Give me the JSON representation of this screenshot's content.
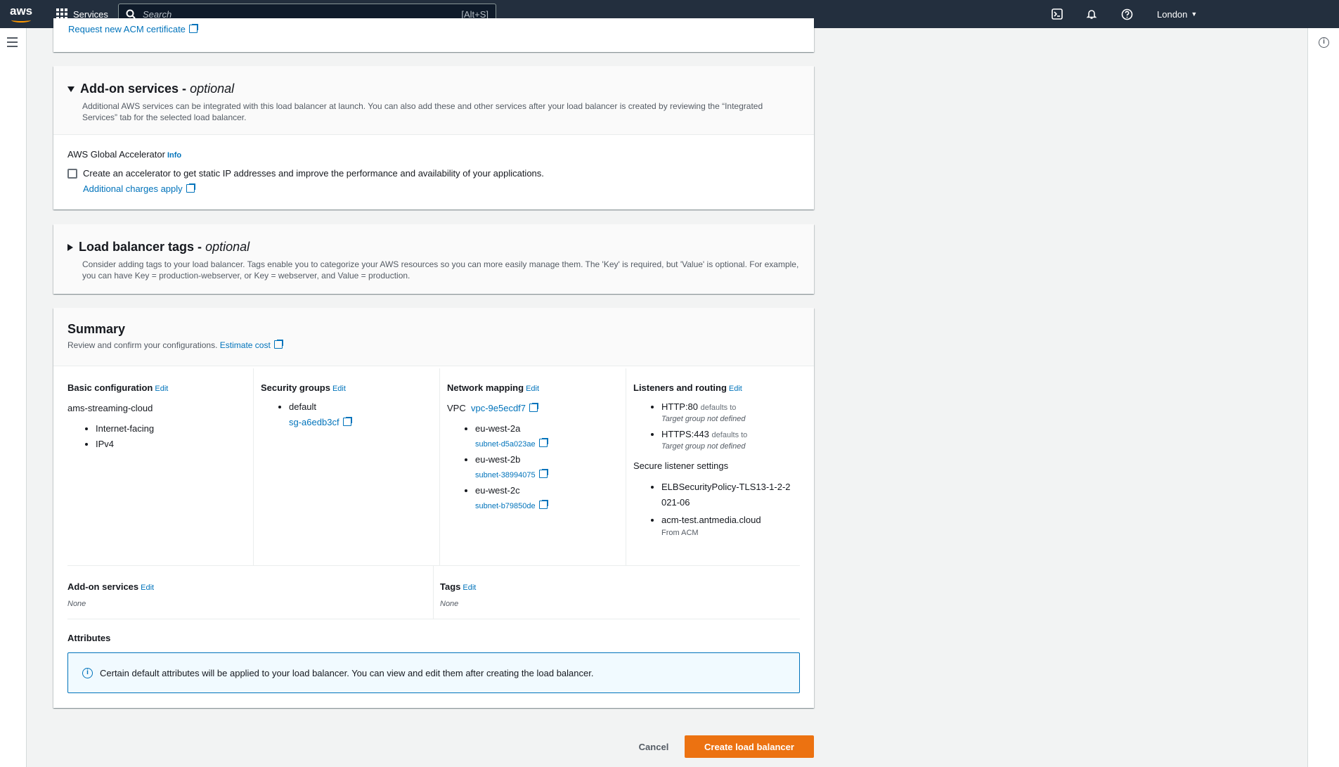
{
  "topnav": {
    "logo": "aws",
    "services": "Services",
    "search_placeholder": "Search",
    "search_shortcut": "[Alt+S]",
    "region": "London",
    "icons": [
      "cloudshell-icon",
      "bell-icon",
      "help-icon"
    ]
  },
  "top_fragment": {
    "link": "Request new ACM certificate"
  },
  "addon": {
    "title": "Add-on services -",
    "title_optional": "optional",
    "desc": "Additional AWS services can be integrated with this load balancer at launch. You can also add these and other services after your load balancer is created by reviewing the “Integrated Services” tab for the selected load balancer.",
    "ga_label": "AWS Global Accelerator",
    "info": "Info",
    "checkbox_text": "Create an accelerator to get static IP addresses and improve the performance and availability of your applications.",
    "charges_link": "Additional charges apply",
    "checked": false
  },
  "tags_panel": {
    "title": "Load balancer tags -",
    "title_optional": "optional",
    "desc": "Consider adding tags to your load balancer. Tags enable you to categorize your AWS resources so you can more easily manage them. The 'Key' is required, but 'Value' is optional. For example, you can have Key = production-webserver, or Key = webserver, and Value = production."
  },
  "summary": {
    "title": "Summary",
    "desc": "Review and confirm your configurations.",
    "estimate_link": "Estimate cost",
    "edit": "Edit",
    "basic": {
      "title": "Basic configuration",
      "name": "ams-streaming-cloud",
      "items": [
        "Internet-facing",
        "IPv4"
      ]
    },
    "security": {
      "title": "Security groups",
      "group_name": "default",
      "group_id": "sg-a6edb3cf"
    },
    "network": {
      "title": "Network mapping",
      "vpc_label": "VPC",
      "vpc_id": "vpc-9e5ecdf7",
      "zones": [
        {
          "az": "eu-west-2a",
          "subnet": "subnet-d5a023ae"
        },
        {
          "az": "eu-west-2b",
          "subnet": "subnet-38994075"
        },
        {
          "az": "eu-west-2c",
          "subnet": "subnet-b79850de"
        }
      ]
    },
    "listeners": {
      "title": "Listeners and routing",
      "items": [
        {
          "proto": "HTTP:80",
          "defaults": "defaults to",
          "target": "Target group not defined"
        },
        {
          "proto": "HTTPS:443",
          "defaults": "defaults to",
          "target": "Target group not defined"
        }
      ],
      "secure_title": "Secure listener settings",
      "policy": "ELBSecurityPolicy-TLS13-1-2-2021-06",
      "cert": "acm-test.antmedia.cloud",
      "cert_source": "From ACM"
    },
    "addons": {
      "title": "Add-on services",
      "value": "None"
    },
    "tags": {
      "title": "Tags",
      "value": "None"
    },
    "attributes": {
      "title": "Attributes",
      "alert": "Certain default attributes will be applied to your load balancer. You can view and edit them after creating the load balancer."
    }
  },
  "actions": {
    "cancel": "Cancel",
    "create": "Create load balancer"
  }
}
